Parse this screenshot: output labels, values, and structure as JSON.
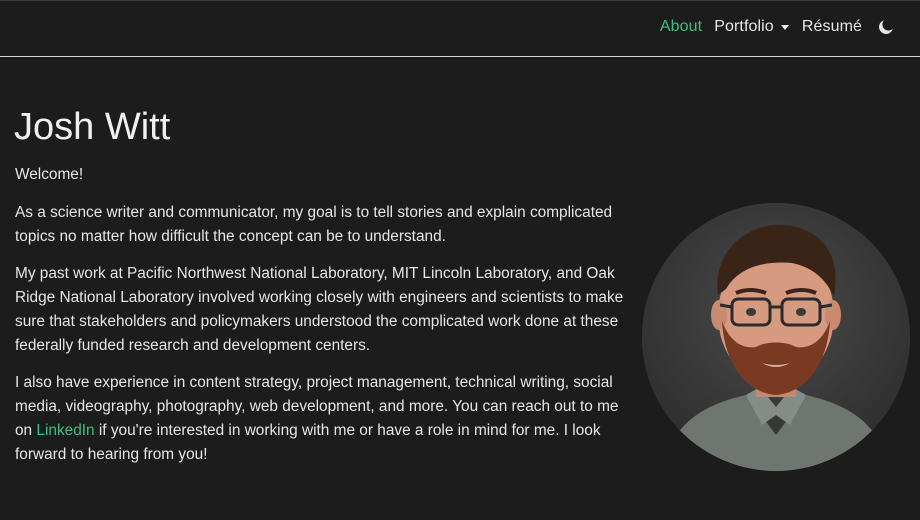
{
  "nav": {
    "about": "About",
    "portfolio": "Portfolio",
    "resume": "Résumé",
    "theme_icon": "moon-icon"
  },
  "colors": {
    "accent": "#3fbf7f",
    "background": "#1c1c1c",
    "text": "#e6e6e6"
  },
  "main": {
    "title": "Josh Witt",
    "welcome": "Welcome!",
    "para1": "As a science writer and communicator, my goal is to tell stories and explain complicated topics no matter how difficult the concept can be to understand.",
    "para2": "My past work at Pacific Northwest National Laboratory, MIT Lincoln Laboratory, and Oak Ridge National Laboratory involved working closely with engineers and scientists to make sure that stakeholders and policymakers understood the complicated work done at these federally funded research and development centers.",
    "para3_before": "I also have experience in content strategy, project management, technical writing, social media, videography, photography, web development, and more. You can reach out to me on ",
    "para3_link": "LinkedIn",
    "para3_after": " if you're interested in working with me or have a role in mind for me. I look forward to hearing from you!"
  }
}
